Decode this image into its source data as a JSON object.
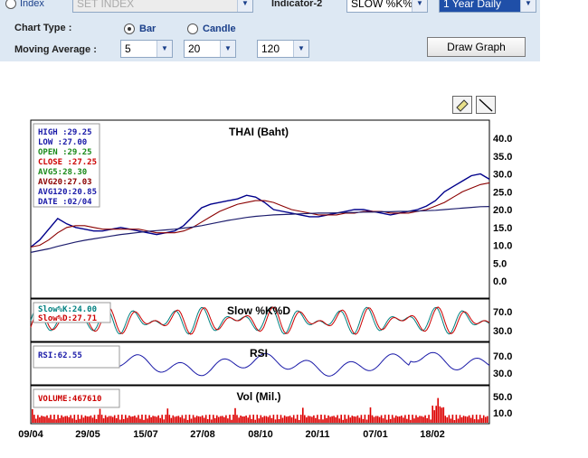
{
  "controls": {
    "index_radio_label": "Index",
    "index_select_value": "SET INDEX",
    "indicator2_label": "Indicator-2",
    "indicator2_value": "SLOW %K%",
    "period_value": "1 Year Daily",
    "chart_type_label": "Chart Type :",
    "chart_type_options": [
      "Bar",
      "Candle"
    ],
    "chart_type_selected": "Bar",
    "moving_average_label": "Moving Average :",
    "moving_average_values": [
      "5",
      "20",
      "120"
    ],
    "draw_button": "Draw Graph"
  },
  "chart": {
    "title": "THAI (Baht)",
    "info": {
      "high": "HIGH :29.25",
      "low": "LOW  :27.00",
      "open": "OPEN :29.25",
      "close": "CLOSE :27.25",
      "avg5": "AVG5:28.30",
      "avg20": "AVG20:27.03",
      "avg120": "AVG120:20.85",
      "date": "DATE :02/04"
    },
    "stoch_title": "Slow %K%D",
    "stoch_k": "Slow%K:24.00",
    "stoch_d": "Slow%D:27.71",
    "rsi_title": "RSI",
    "rsi_value": "RSI:62.55",
    "vol_title": "Vol (Mil.)",
    "vol_value": "VOLUME:467610",
    "colors": {
      "price": "#00008b",
      "ma_short": "#8b0000",
      "ma_long": "#1e1e6e",
      "k": "#008080",
      "d": "#cc0000",
      "rsi": "#1a1aa8",
      "vol": "#dd0000"
    }
  },
  "chart_data": {
    "type": "line",
    "title": "THAI (Baht)",
    "x_ticks": [
      "09/04",
      "29/05",
      "15/07",
      "27/08",
      "08/10",
      "20/11",
      "07/01",
      "18/02"
    ],
    "price_ticks": [
      "40.0",
      "35.0",
      "30.0",
      "25.0",
      "20.0",
      "15.0",
      "10.0",
      "5.0",
      "0.0"
    ],
    "stoch_ticks": [
      "70.0",
      "30.0"
    ],
    "rsi_ticks": [
      "70.0",
      "30.0"
    ],
    "vol_ticks": [
      "50.0",
      "10.0"
    ],
    "ylim_price": [
      0,
      40
    ],
    "series": [
      {
        "name": "Price",
        "values": [
          9.5,
          11.5,
          14.5,
          17.5,
          16,
          15,
          14.5,
          14,
          14,
          14.5,
          15,
          14.5,
          14,
          13.5,
          13,
          13.5,
          14,
          15.5,
          18,
          20.5,
          21.5,
          22,
          22.5,
          23,
          24,
          23.5,
          22,
          20,
          19.5,
          19,
          18.5,
          18,
          18,
          18.5,
          19,
          19.5,
          20,
          20,
          19.5,
          19,
          18.5,
          19,
          19.5,
          20,
          21,
          22.5,
          25,
          26.5,
          28,
          29.5,
          30,
          28.5
        ]
      },
      {
        "name": "AVG20",
        "values": [
          9.5,
          10,
          11.5,
          13.5,
          15,
          15.5,
          15.5,
          15,
          14.5,
          14.5,
          14.5,
          14.5,
          14.5,
          14,
          13.5,
          13.5,
          13.5,
          14,
          15,
          16.5,
          18,
          19.5,
          20.5,
          21.5,
          22,
          22.5,
          22.5,
          22,
          21,
          20,
          19.5,
          19,
          18.5,
          18.5,
          18.5,
          19,
          19,
          19.5,
          19.5,
          19.5,
          19,
          19,
          19,
          19.5,
          20,
          21,
          22,
          23.5,
          25,
          26,
          27,
          27.5
        ]
      },
      {
        "name": "AVG120",
        "values": [
          8,
          8.5,
          9,
          9.7,
          10.3,
          10.9,
          11.4,
          11.8,
          12.2,
          12.6,
          13,
          13.3,
          13.6,
          13.9,
          14.1,
          14.3,
          14.5,
          14.8,
          15.1,
          15.5,
          16,
          16.5,
          17,
          17.4,
          17.8,
          18.1,
          18.3,
          18.5,
          18.6,
          18.7,
          18.8,
          18.9,
          19,
          19,
          19.1,
          19.2,
          19.2,
          19.3,
          19.3,
          19.4,
          19.4,
          19.5,
          19.5,
          19.6,
          19.7,
          19.8,
          20,
          20.2,
          20.4,
          20.6,
          20.8,
          20.85
        ]
      }
    ]
  }
}
